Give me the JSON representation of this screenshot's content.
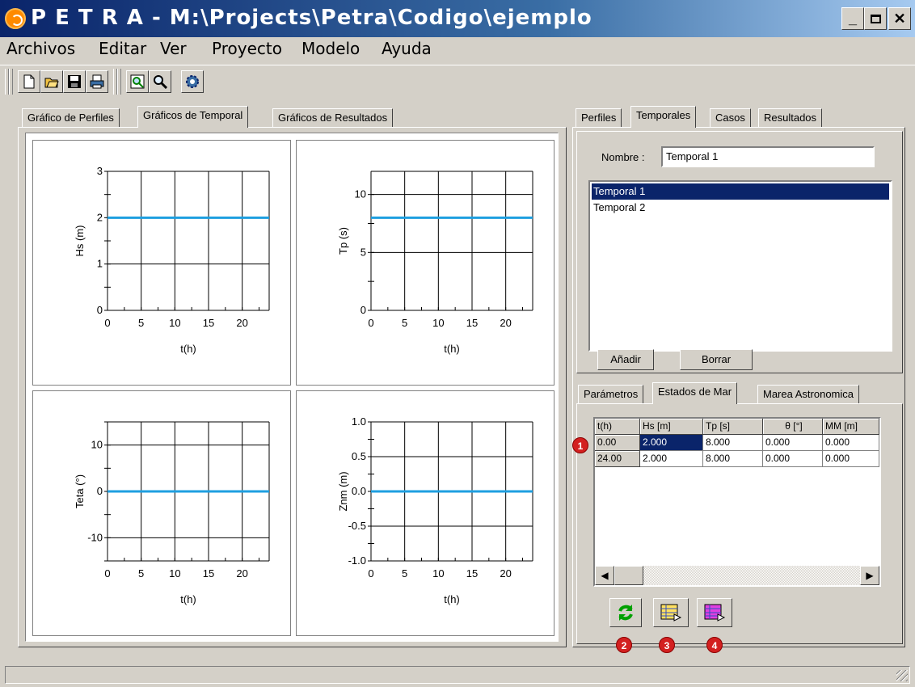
{
  "window": {
    "title": "P E T R A - M:\\Projects\\Petra\\Codigo\\ejemplo"
  },
  "menu": [
    "Archivos",
    "Editar",
    "Ver",
    "Proyecto",
    "Modelo",
    "Ayuda"
  ],
  "toolbar": {
    "icons": [
      "new-file-icon",
      "open-folder-icon",
      "save-icon",
      "print-icon",
      "preview-icon",
      "zoom-icon",
      "settings-gear-icon"
    ]
  },
  "left_tabs": [
    "Gráfico de Perfiles",
    "Gráficos de Temporal",
    "Gráficos de Resultados"
  ],
  "right_tabs": [
    "Perfiles",
    "Temporales",
    "Casos",
    "Resultados"
  ],
  "temporal": {
    "name_label": "Nombre :",
    "name_value": "Temporal 1",
    "list": [
      "Temporal 1",
      "Temporal 2"
    ],
    "add_label": "Añadir",
    "delete_label": "Borrar"
  },
  "sub_tabs": [
    "Parámetros",
    "Estados de Mar",
    "Marea Astronomica"
  ],
  "grid": {
    "headers": [
      "t(h)",
      "Hs [m]",
      "Tp [s]",
      "θ [°]",
      "MM [m]"
    ],
    "rows": [
      [
        "0.00",
        "2.000",
        "8.000",
        "0.000",
        "0.000"
      ],
      [
        "24.00",
        "2.000",
        "8.000",
        "0.000",
        "0.000"
      ]
    ]
  },
  "badges": [
    "1",
    "2",
    "3",
    "4"
  ],
  "action_icons": [
    "refresh-icon",
    "table-export-icon",
    "table-import-icon"
  ],
  "colors": {
    "title_start": "#0a246a",
    "series": "#1e9fe0",
    "selection": "#0a246a"
  },
  "chart_data": [
    {
      "type": "line",
      "x": [
        0,
        24
      ],
      "y": [
        2,
        2
      ],
      "ylabel": "Hs (m)",
      "xlabel": "t(h)",
      "xlim": [
        0,
        24
      ],
      "ylim": [
        0,
        3
      ],
      "xticks": [
        "0",
        "5",
        "10",
        "15",
        "20"
      ],
      "yticks": [
        "0",
        "1",
        "2",
        "3"
      ],
      "grid": true
    },
    {
      "type": "line",
      "x": [
        0,
        24
      ],
      "y": [
        8,
        8
      ],
      "ylabel": "Tp (s)",
      "xlabel": "t(h)",
      "xlim": [
        0,
        24
      ],
      "ylim": [
        0,
        12
      ],
      "xticks": [
        "0",
        "5",
        "10",
        "15",
        "20"
      ],
      "yticks": [
        "0",
        "5",
        "10"
      ],
      "grid": true
    },
    {
      "type": "line",
      "x": [
        0,
        24
      ],
      "y": [
        0,
        0
      ],
      "ylabel": "Teta (°)",
      "xlabel": "t(h)",
      "xlim": [
        0,
        24
      ],
      "ylim": [
        -15,
        15
      ],
      "xticks": [
        "0",
        "5",
        "10",
        "15",
        "20"
      ],
      "yticks": [
        "-10",
        "0",
        "10"
      ],
      "grid": true
    },
    {
      "type": "line",
      "x": [
        0,
        24
      ],
      "y": [
        0,
        0
      ],
      "ylabel": "Znm (m)",
      "xlabel": "t(h)",
      "xlim": [
        0,
        24
      ],
      "ylim": [
        -1,
        1
      ],
      "xticks": [
        "0",
        "5",
        "10",
        "15",
        "20"
      ],
      "yticks": [
        "-1.0",
        "-0.5",
        "0.0",
        "0.5",
        "1.0"
      ],
      "grid": true
    }
  ]
}
